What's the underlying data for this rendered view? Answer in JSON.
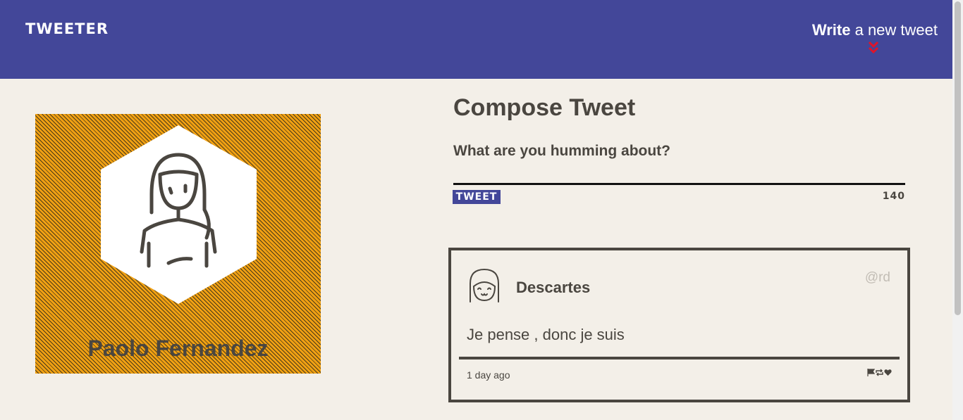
{
  "navbar": {
    "brand": "TWEETER",
    "write_bold": "Write",
    "write_rest": " a new tweet",
    "accent_color": "#434799",
    "chevron_color": "#e0142a"
  },
  "profile": {
    "name": "Paolo Fernandez",
    "background_color": "#f0a012"
  },
  "compose": {
    "title": "Compose Tweet",
    "placeholder": "What are you humming about?",
    "button_label": "TWEET",
    "counter": "140"
  },
  "tweets": [
    {
      "author": "Descartes",
      "handle": "@rd",
      "content": "Je pense , donc je suis",
      "time": "1 day ago",
      "actions": [
        "flag-icon",
        "retweet-icon",
        "heart-icon"
      ]
    }
  ]
}
